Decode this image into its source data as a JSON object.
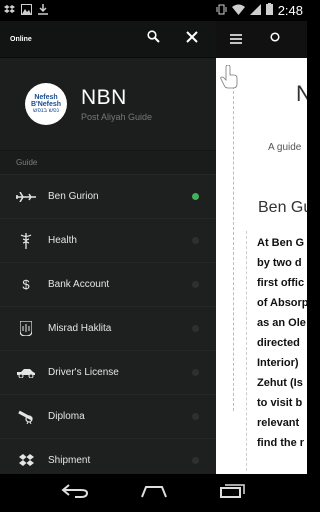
{
  "status_bar": {
    "time": "2:48",
    "left_icons": [
      "dropbox-icon",
      "image-icon",
      "download-icon"
    ],
    "right_icons": [
      "vibrate-icon",
      "wifi-icon",
      "signal-icon",
      "battery-icon"
    ]
  },
  "drawer": {
    "top_bar": {
      "status_text": "Online",
      "icons": [
        "search-icon",
        "close-icon"
      ]
    },
    "header": {
      "logo_line1": "Nefesh",
      "logo_line2": "B'Nefesh",
      "logo_line3": "נפש בנפש",
      "app_name": "NBN",
      "tagline": "Post Aliyah Guide"
    },
    "section_label": "Guide",
    "items": [
      {
        "label": "Ben Gurion",
        "icon": "airplane-icon",
        "active": true
      },
      {
        "label": "Health",
        "icon": "caduceus-icon",
        "active": false
      },
      {
        "label": "Bank Account",
        "icon": "dollar-icon",
        "active": false
      },
      {
        "label": "Misrad Haklita",
        "icon": "emblem-icon",
        "active": false
      },
      {
        "label": "Driver's License",
        "icon": "car-icon",
        "active": false
      },
      {
        "label": "Diploma",
        "icon": "diploma-icon",
        "active": false
      },
      {
        "label": "Shipment",
        "icon": "dropbox-icon",
        "active": false
      }
    ],
    "active_color": "#3cb45a"
  },
  "main": {
    "top_icons": [
      "menu-icon"
    ],
    "partial_title": "N",
    "partial_guide": "A guide",
    "section_title": "Ben Gu",
    "body_lines": [
      "At Ben G",
      "by two d",
      "first offic",
      "of Absorp",
      "as an Ole",
      "directed",
      "Interior)",
      "Zehut (Is",
      "to visit b",
      "relevant",
      "find the r"
    ]
  },
  "nav_bar": {
    "icons": [
      "back-icon",
      "home-icon",
      "recents-icon"
    ]
  }
}
